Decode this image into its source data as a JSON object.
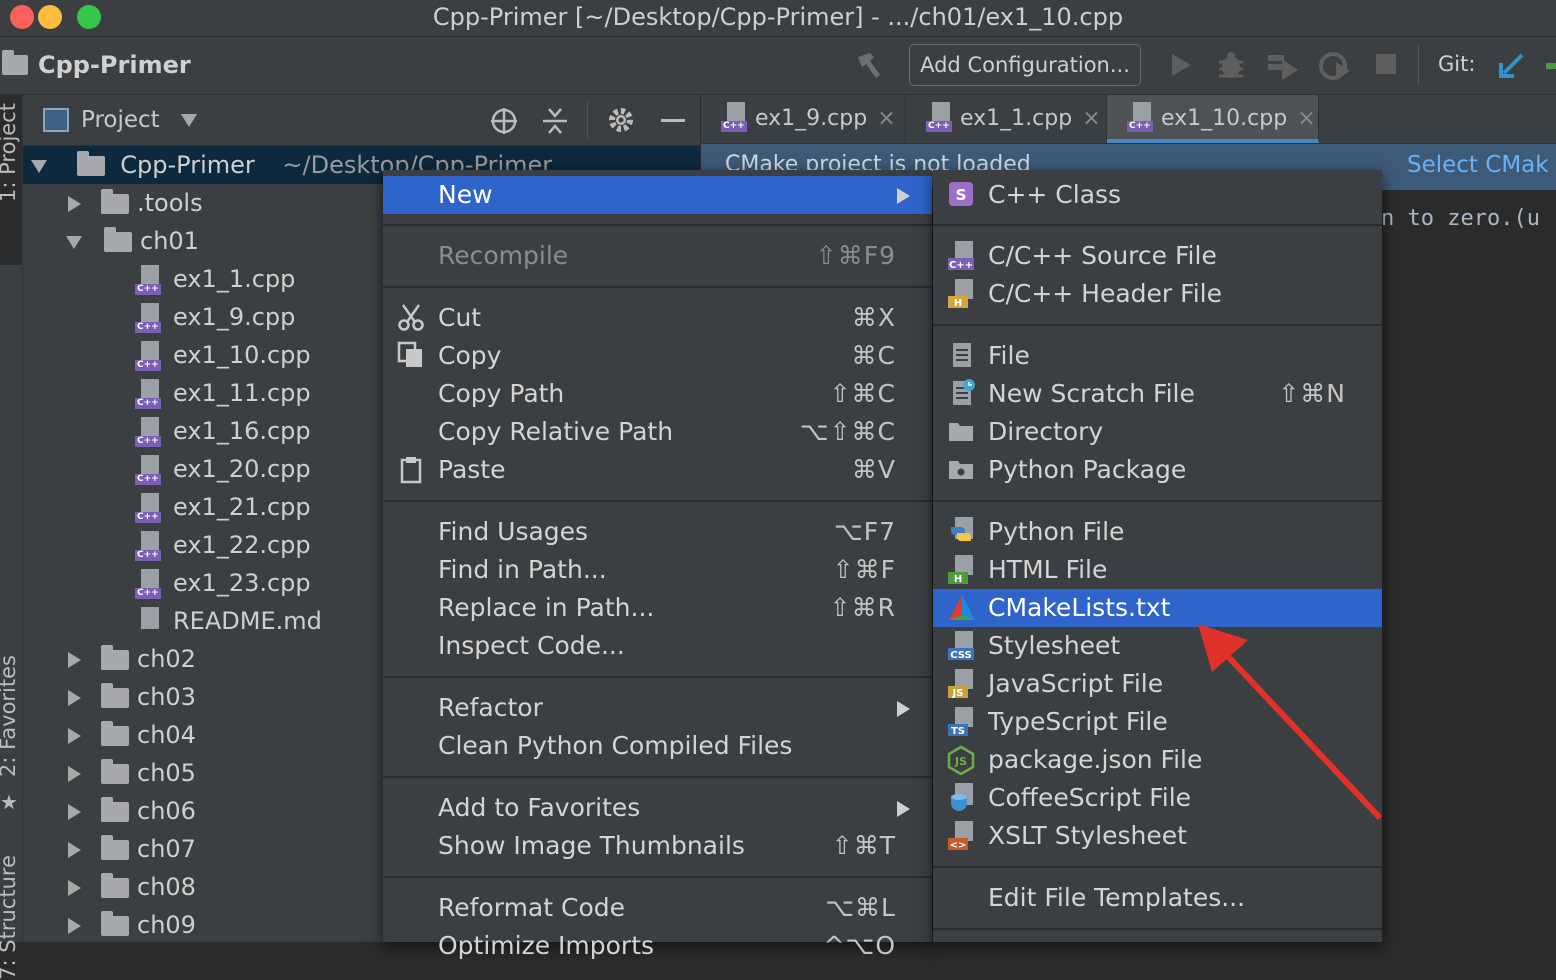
{
  "window": {
    "title": "Cpp-Primer [~/Desktop/Cpp-Primer] - .../ch01/ex1_10.cpp"
  },
  "navbar": {
    "project_name": "Cpp-Primer",
    "add_configuration": "Add Configuration...",
    "git_label": "Git:"
  },
  "side_tabs": {
    "project": "1: Project",
    "favorites": "2: Favorites",
    "structure": "7: Structure"
  },
  "project_panel": {
    "title": "Project",
    "root": {
      "name": "Cpp-Primer",
      "path": "~/Desktop/Cpp-Primer"
    },
    "items": [
      {
        "label": ".tools",
        "type": "folder"
      },
      {
        "label": "ch01",
        "type": "folder"
      },
      {
        "label": "ex1_1.cpp",
        "type": "cpp"
      },
      {
        "label": "ex1_9.cpp",
        "type": "cpp"
      },
      {
        "label": "ex1_10.cpp",
        "type": "cpp"
      },
      {
        "label": "ex1_11.cpp",
        "type": "cpp"
      },
      {
        "label": "ex1_16.cpp",
        "type": "cpp"
      },
      {
        "label": "ex1_20.cpp",
        "type": "cpp"
      },
      {
        "label": "ex1_21.cpp",
        "type": "cpp"
      },
      {
        "label": "ex1_22.cpp",
        "type": "cpp"
      },
      {
        "label": "ex1_23.cpp",
        "type": "cpp"
      },
      {
        "label": "README.md",
        "type": "md"
      },
      {
        "label": "ch02",
        "type": "folder"
      },
      {
        "label": "ch03",
        "type": "folder"
      },
      {
        "label": "ch04",
        "type": "folder"
      },
      {
        "label": "ch05",
        "type": "folder"
      },
      {
        "label": "ch06",
        "type": "folder"
      },
      {
        "label": "ch07",
        "type": "folder"
      },
      {
        "label": "ch08",
        "type": "folder"
      },
      {
        "label": "ch09",
        "type": "folder"
      }
    ]
  },
  "editor": {
    "tabs": [
      {
        "label": "ex1_9.cpp"
      },
      {
        "label": "ex1_1.cpp"
      },
      {
        "label": "ex1_10.cpp",
        "active": true
      }
    ],
    "close_glyph": "×",
    "notice": {
      "message": "CMake project is not loaded",
      "action": "Select CMak"
    },
    "code_fragment": "n to zero.(u"
  },
  "context_menu": {
    "items": [
      {
        "label": "New",
        "submenu": true,
        "highlighted": true
      },
      {
        "label": "Recompile",
        "shortcut": "⇧⌘F9",
        "disabled": true
      },
      {
        "label": "Cut",
        "shortcut": "⌘X",
        "icon": "scissors-icon"
      },
      {
        "label": "Copy",
        "shortcut": "⌘C",
        "icon": "copy-icon"
      },
      {
        "label": "Copy Path",
        "shortcut": "⇧⌘C"
      },
      {
        "label": "Copy Relative Path",
        "shortcut": "⌥⇧⌘C"
      },
      {
        "label": "Paste",
        "shortcut": "⌘V",
        "icon": "clipboard-icon"
      },
      {
        "label": "Find Usages",
        "shortcut": "⌥F7"
      },
      {
        "label": "Find in Path...",
        "shortcut": "⇧⌘F"
      },
      {
        "label": "Replace in Path...",
        "shortcut": "⇧⌘R"
      },
      {
        "label": "Inspect Code..."
      },
      {
        "label": "Refactor",
        "submenu": true
      },
      {
        "label": "Clean Python Compiled Files"
      },
      {
        "label": "Add to Favorites",
        "submenu": true
      },
      {
        "label": "Show Image Thumbnails",
        "shortcut": "⇧⌘T"
      },
      {
        "label": "Reformat Code",
        "shortcut": "⌥⌘L"
      },
      {
        "label": "Optimize Imports",
        "shortcut": "^⌥O"
      }
    ]
  },
  "new_submenu": {
    "items": [
      {
        "label": "C++ Class",
        "icon": "cpp-class-icon",
        "icon_text": "S"
      },
      {
        "label": "C/C++ Source File",
        "icon": "cpp-source-icon",
        "icon_text": "C++"
      },
      {
        "label": "C/C++ Header File",
        "icon": "cpp-header-icon",
        "icon_text": "H"
      },
      {
        "label": "File",
        "icon": "file-icon"
      },
      {
        "label": "New Scratch File",
        "shortcut": "⇧⌘N",
        "icon": "scratch-file-icon"
      },
      {
        "label": "Directory",
        "icon": "folder-icon"
      },
      {
        "label": "Python Package",
        "icon": "python-package-icon"
      },
      {
        "label": "Python File",
        "icon": "python-file-icon"
      },
      {
        "label": "HTML File",
        "icon": "html-file-icon",
        "icon_text": "H"
      },
      {
        "label": "CMakeLists.txt",
        "icon": "cmake-icon",
        "highlighted": true
      },
      {
        "label": "Stylesheet",
        "icon": "css-icon",
        "icon_text": "CSS"
      },
      {
        "label": "JavaScript File",
        "icon": "js-icon",
        "icon_text": "JS"
      },
      {
        "label": "TypeScript File",
        "icon": "ts-icon",
        "icon_text": "TS"
      },
      {
        "label": "package.json File",
        "icon": "nodejs-icon",
        "icon_text": "JS"
      },
      {
        "label": "CoffeeScript File",
        "icon": "coffeescript-icon"
      },
      {
        "label": "XSLT Stylesheet",
        "icon": "xslt-icon",
        "icon_text": "<>"
      },
      {
        "label": "Edit File Templates..."
      }
    ]
  },
  "colors": {
    "highlight": "#2f65ca",
    "panel": "#3c3f41",
    "editor_bg": "#2b2b2b",
    "annotation_arrow": "#e0322b"
  }
}
